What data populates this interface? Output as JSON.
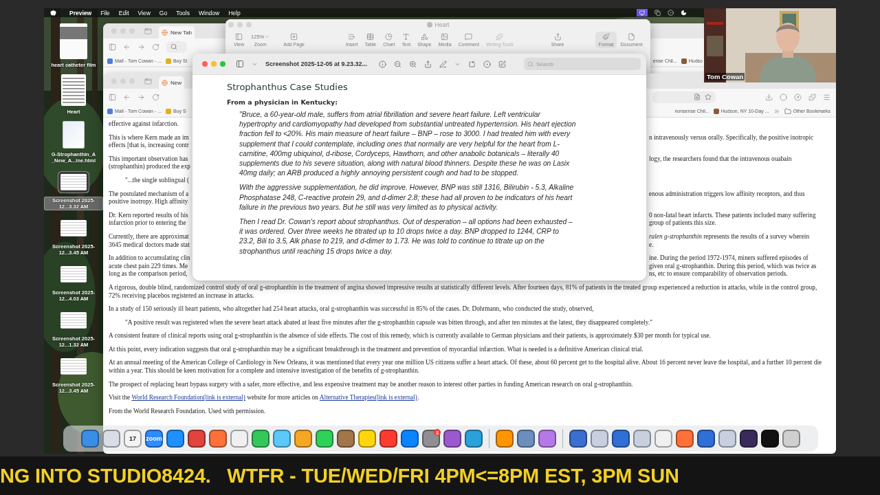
{
  "menu_bar": {
    "app": "Preview",
    "menus": [
      "File",
      "Edit",
      "View",
      "Go",
      "Tools",
      "Window",
      "Help"
    ]
  },
  "desktop_icons": [
    {
      "label": "heart catheter film",
      "selected": false
    },
    {
      "label": "Heart",
      "kind": "document",
      "selected": false
    },
    {
      "label": "G-Strophanthin_A _New_A...ine.html",
      "kind": "html",
      "selected": false
    },
    {
      "label": "Screenshot 2025-12...3.32 AM",
      "kind": "screenshot",
      "selected": true
    },
    {
      "label": "Screenshot 2025-12...3.45 AM",
      "kind": "screenshot",
      "selected": false
    },
    {
      "label": "Screenshot 2025-12...4.03 AM",
      "kind": "screenshot",
      "selected": false
    },
    {
      "label": "Screenshot 2025-12...1.32 AM",
      "kind": "screenshot",
      "selected": false
    },
    {
      "label": "Screenshot 2025-12...3.45 AM",
      "kind": "screenshot",
      "selected": false
    }
  ],
  "back_browser": {
    "active": false,
    "tab": "New Tab",
    "bookmarks_left": [
      "Mail - Tom Cowan - ...",
      "Buy Si"
    ],
    "bookmarks_right": [
      "ense Chil...",
      "Hudso"
    ]
  },
  "pages_window": {
    "active": false,
    "title": "Heart",
    "zoom": "125%",
    "tools": [
      {
        "label": "View",
        "selected": false,
        "disabled": false
      },
      {
        "label": "Zoom",
        "selected": false,
        "disabled": false
      },
      {
        "label": "Add Page",
        "selected": false,
        "disabled": false
      },
      {
        "label": "Insert",
        "selected": false,
        "disabled": false
      },
      {
        "label": "Table",
        "selected": false,
        "disabled": false
      },
      {
        "label": "Chart",
        "selected": false,
        "disabled": false
      },
      {
        "label": "Text",
        "selected": false,
        "disabled": false
      },
      {
        "label": "Shape",
        "selected": false,
        "disabled": false
      },
      {
        "label": "Media",
        "selected": false,
        "disabled": false
      },
      {
        "label": "Comment",
        "selected": false,
        "disabled": false
      },
      {
        "label": "Writing Tools",
        "selected": false,
        "disabled": true
      },
      {
        "label": "Share",
        "selected": false,
        "disabled": false
      },
      {
        "label": "Format",
        "selected": true,
        "disabled": false
      },
      {
        "label": "Document",
        "selected": false,
        "disabled": false
      }
    ]
  },
  "browser": {
    "active": false,
    "tab": "New",
    "bookmarks_left": [
      "Mail - Tom Cowan - ...",
      "Buy S"
    ],
    "bookmarks_right": [
      "nonsense Chil...",
      "Hudson, NY 10-Day ..."
    ],
    "other": "Other Bookmarks",
    "article": [
      {
        "kind": "split",
        "lines": [
          {
            "left": "effective against infarction."
          }
        ]
      },
      {
        "kind": "split",
        "lines": [
          {
            "left": "This is where Kern made an im",
            "right": "n intravenously versus orally. Specifically, the positive inotropic"
          },
          {
            "left": "effects [that is, increasing contr"
          }
        ]
      },
      {
        "kind": "split",
        "lines": [
          {
            "left": "This important observation has",
            "right": "logy, the researchers found that the intravenous ouabain"
          },
          {
            "left": "(strophanthin) produced the exp"
          }
        ]
      },
      {
        "kind": "quote_fragment",
        "text": "\"...the single sublingual ("
      },
      {
        "kind": "split",
        "lines": [
          {
            "left": "The postulated mechanism of a",
            "right": "enous administration triggers low affinity receptors, and thus"
          },
          {
            "left": "positive inotropy. High affinity"
          }
        ]
      },
      {
        "kind": "split",
        "lines": [
          {
            "left": "Dr. Kern reported results of his",
            "right": "0 non-fatal heart infarcts. These patients included many suffering"
          },
          {
            "left": "infarction prior to entering the",
            "right": "group of patients this size."
          }
        ]
      },
      {
        "kind": "split",
        "lines": [
          {
            "left": "Currently, there are approximat",
            "right": "*ralen g-strophanthin* represents the results of a survey wherein"
          },
          {
            "left": "3645 medical doctors made stat",
            "right": "e."
          }
        ]
      },
      {
        "kind": "split",
        "lines": [
          {
            "left": "In addition to accumulating clin",
            "right": "ine. During the period 1972-1974, miners suffered episodes of"
          },
          {
            "left": "acute chest pain 229 times. Me",
            "right": "given oral g-strophanthin. During this period, which was twice as"
          },
          {
            "left": "long as the comparison period,",
            "right": "ns, etc to ensure comparability of observation periods."
          }
        ]
      },
      {
        "kind": "text",
        "text": "A rigorous, double blind, randomized control study of oral g-strophanthin in the treatment of angina showed impressive results at statistically different levels. After fourteen days, 81% of patients in the treated group experienced a reduction in attacks, while in the control group, 72% receiving placebos registered an increase in attacks."
      },
      {
        "kind": "text",
        "text": "In a study of 150 seriously ill heart patients, who altogether had 254 heart attacks, oral g-strophanthin was successful in 85% of the cases. Dr. Dohrmann, who conducted the study, observed,"
      },
      {
        "kind": "quote",
        "text": "\"A positive result was registered when the severe heart attack abated at least five minutes after the g-strophanthin capsule was bitten through, and after ten minutes at the latest, they disappeared completely.\""
      },
      {
        "kind": "text",
        "text": "A consistent feature of clinical reports using oral g-strophanthin is the absence of side effects. The cost of this remedy, which is currently available to German physicians and their patients, is approximately $30 per month for typical use."
      },
      {
        "kind": "text",
        "text": "At this point, every indication suggests that oral g-strophanthin may be a significant breakthrough in the treatment and prevention of myocardial infarction. What is needed is a definitive American clinical trial."
      },
      {
        "kind": "text",
        "text": "At an annual meeting of the American College of Cardiology in New Orleans, it was mentioned that every year one million US citizens suffer a heart attack. Of these, about 60 percent get to the hospital alive. About 16 percent never leave the hospital, and a further 10 percent die within a year. This should be keen motivation for a complete and intensive investigation of the benefits of g-strophanthin."
      },
      {
        "kind": "text",
        "text": "The prospect of replacing heart bypass surgery with a safer, more effective, and less expensive treatment may be another reason to interest other parties in funding American research on oral g-strophanthin."
      },
      {
        "kind": "links",
        "parts": [
          {
            "text": "Visit the ",
            "kind": "plain"
          },
          {
            "text": "World Research Foundation(link is external)",
            "kind": "link"
          },
          {
            "text": " website for more articles on ",
            "kind": "plain"
          },
          {
            "text": "Alternative Therapies(link is external)",
            "kind": "link"
          },
          {
            "text": ".",
            "kind": "plain"
          }
        ]
      },
      {
        "kind": "text",
        "text": "From the World Research Foundation. Used with permission."
      }
    ]
  },
  "preview": {
    "active": true,
    "title": "Screenshot 2025-12-05 at 9.23.32...",
    "search": {
      "placeholder": "Search"
    },
    "heading": "Strophanthus Case Studies",
    "subheading": "From a physician in Kentucky:",
    "paragraphs": [
      "\"Bruce, a 60-year-old male, suffers from atrial fibrillation and severe heart failure. Left ventricular hypertrophy and cardiomyopathy had developed from substantial untreated hypertension. His heart ejection fraction fell to <20%. His main measure of heart failure – BNP – rose to 3000. I had treated him with every supplement that I could contemplate, including ones that normally are very helpful for the heart from L-carnitine, 400mg ubiquinol, d-ribose, Cordyceps, Hawthorn, and other anabolic botanicals – literally 40 supplements due to his severe situation, along with natural blood thinners. Despite these he was on Lasix 40mg daily; an ARB produced a highly annoying persistent cough and had to be stopped.",
      "With the aggressive supplementation, he did improve. However, BNP was still 1316, Bilirubin - 5.3, Alkaline Phosphatase 248, C-reactive protein 29, and d-dimer 2.8; these had all proven to be indicators of his heart failure in the previous two years. But he still was very limited as to physical activity.",
      "Then I read Dr. Cowan's report about strophanthus. Out of desperation – all options had been exhausted – it was ordered. Over three weeks he titrated up to 10 drops twice a day. BNP dropped to 1244, CRP to 23.2, Bili to 3.5, Alk phase to 219, and d-dimer to 1.73. He was told to continue to titrate up on the strophanthus until reaching 15 drops twice a day."
    ]
  },
  "webcam": {
    "name": "Tom Cowan"
  },
  "dock": [
    {
      "kind": "app",
      "color": "#3a8ee6"
    },
    {
      "kind": "app",
      "color": "#d9dde6"
    },
    {
      "kind": "app",
      "color": "#f4f4f4",
      "label": "17"
    },
    {
      "kind": "app",
      "color": "#2d8cff",
      "label": "zoom"
    },
    {
      "kind": "app",
      "color": "#1e90ff"
    },
    {
      "kind": "app",
      "color": "#e0443c"
    },
    {
      "kind": "app",
      "color": "#ff7139"
    },
    {
      "kind": "app",
      "color": "#f0f0f0"
    },
    {
      "kind": "app",
      "color": "#34c759"
    },
    {
      "kind": "app",
      "color": "#5ac8fa"
    },
    {
      "kind": "app",
      "color": "#f5a623"
    },
    {
      "kind": "app",
      "color": "#30d158"
    },
    {
      "kind": "app",
      "color": "#a0764a"
    },
    {
      "kind": "app",
      "color": "#ffd60a"
    },
    {
      "kind": "app",
      "color": "#ff3b30"
    },
    {
      "kind": "app",
      "color": "#0a84ff"
    },
    {
      "kind": "app",
      "color": "#8e8e93",
      "badge": "3"
    },
    {
      "kind": "app",
      "color": "#9b59d0"
    },
    {
      "kind": "app",
      "color": "#2aa1da"
    },
    {
      "kind": "divider"
    },
    {
      "kind": "app",
      "color": "#ff9500"
    },
    {
      "kind": "app",
      "color": "#6c8ebf"
    },
    {
      "kind": "app",
      "color": "#b678e8"
    },
    {
      "kind": "divider"
    },
    {
      "kind": "app",
      "color": "#3a6fd0"
    },
    {
      "kind": "app",
      "color": "#c8d0e0"
    },
    {
      "kind": "app",
      "color": "#2f6fd6"
    },
    {
      "kind": "app",
      "color": "#c8d0e0"
    },
    {
      "kind": "app",
      "color": "#f0f0f0"
    },
    {
      "kind": "app",
      "color": "#ff7139"
    },
    {
      "kind": "app",
      "color": "#2f6fd6"
    },
    {
      "kind": "app",
      "color": "#c8d0e0"
    },
    {
      "kind": "app",
      "color": "#3a2a5a"
    },
    {
      "kind": "app",
      "color": "#111111"
    },
    {
      "kind": "app",
      "color": "#cfcfcf"
    }
  ],
  "ticker": "NG INTO STUDIO8424.   WTFR - TUE/WED/FRI 4PM<=8PM EST, 3PM SUN"
}
